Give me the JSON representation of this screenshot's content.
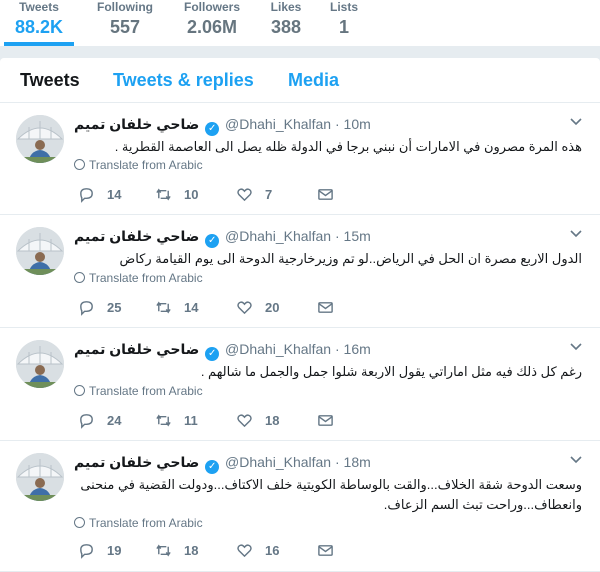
{
  "stats": [
    {
      "label": "Tweets",
      "value": "88.2K"
    },
    {
      "label": "Following",
      "value": "557"
    },
    {
      "label": "Followers",
      "value": "2.06M"
    },
    {
      "label": "Likes",
      "value": "388"
    },
    {
      "label": "Lists",
      "value": "1"
    }
  ],
  "tabs": [
    "Tweets",
    "Tweets & replies",
    "Media"
  ],
  "accent_color": "#1da1f2",
  "tweets": [
    {
      "name": "ضاحي خلفان تميم",
      "handle": "@Dhahi_Khalfan",
      "time": "10m",
      "text": "هذه المرة مصرون في الامارات أن نبني برجا في الدولة ظله يصل الى العاصمة القطرية .",
      "translate": "Translate from Arabic",
      "replies": "14",
      "retweets": "10",
      "likes": "7"
    },
    {
      "name": "ضاحي خلفان تميم",
      "handle": "@Dhahi_Khalfan",
      "time": "15m",
      "text": "الدول الاربع مصرة ان الحل في الرياض..لو تم وزيرخارجية الدوحة الى يوم القيامة ركاض",
      "translate": "Translate from Arabic",
      "replies": "25",
      "retweets": "14",
      "likes": "20"
    },
    {
      "name": "ضاحي خلفان تميم",
      "handle": "@Dhahi_Khalfan",
      "time": "16m",
      "text": "رغم كل ذلك فيه مثل اماراتي يقول الاربعة شلوا جمل والجمل ما شالهم .",
      "translate": "Translate from Arabic",
      "replies": "24",
      "retweets": "11",
      "likes": "18"
    },
    {
      "name": "ضاحي خلفان تميم",
      "handle": "@Dhahi_Khalfan",
      "time": "18m",
      "text": "وسعت الدوحة شقة الخلاف...والقت بالوساطة الكويتية خلف الاكتاف...ودولت القضية في منحنى وانعطاف...وراحت تبث السم الزعاف.",
      "translate": "Translate from Arabic",
      "replies": "19",
      "retweets": "18",
      "likes": "16"
    }
  ]
}
